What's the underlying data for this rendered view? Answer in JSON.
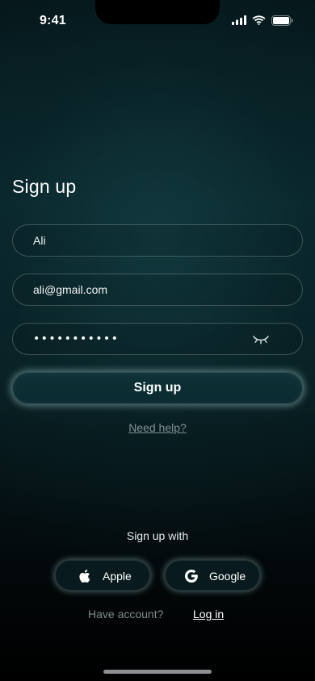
{
  "status_bar": {
    "time": "9:41",
    "icons": [
      "cellular-signal-icon",
      "wifi-icon",
      "battery-icon"
    ]
  },
  "form": {
    "title": "Sign up",
    "name_value": "Ali",
    "email_value": "ali@gmail.com",
    "password_mask": "•••••••••••",
    "password_toggle_icon": "eye-closed-icon",
    "submit_label": "Sign up",
    "help_link": "Need help?"
  },
  "social": {
    "heading": "Sign up with",
    "apple_label": "Apple",
    "apple_icon": "apple-icon",
    "google_label": "Google",
    "google_icon": "google-icon"
  },
  "footer": {
    "have_account_text": "Have account?",
    "login_label": "Log in"
  },
  "colors": {
    "background_top": "#05161a",
    "background_mid": "#0a2a2f",
    "background_bottom": "#000000",
    "muted_text": "#7e8a8c",
    "glow": "#bee6e6"
  }
}
